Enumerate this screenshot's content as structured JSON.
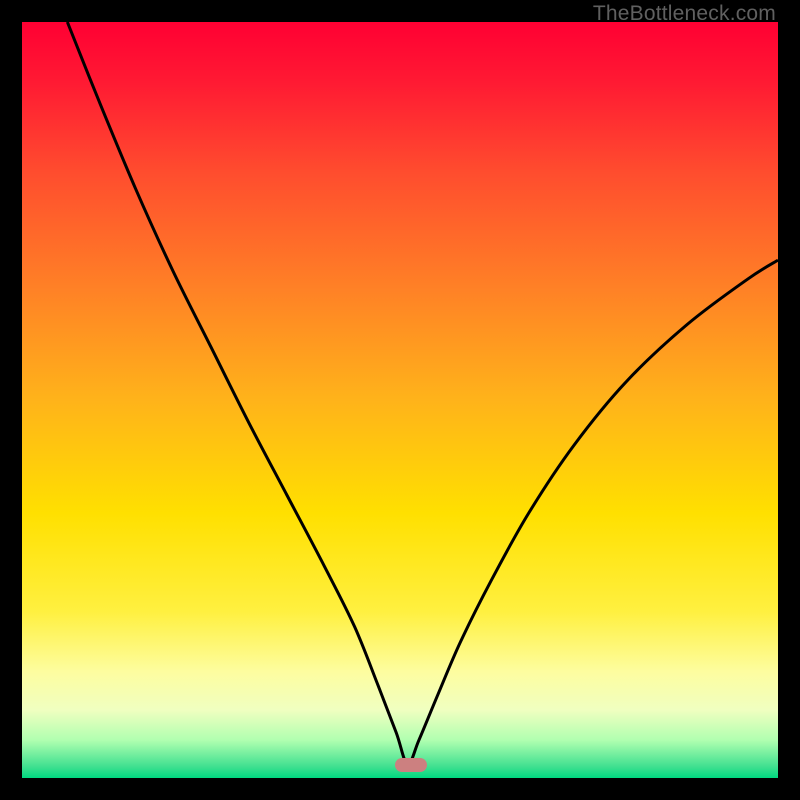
{
  "watermark_text": "TheBottleneck.com",
  "gradient_stops": [
    {
      "offset": 0.0,
      "color": "#ff0033"
    },
    {
      "offset": 0.08,
      "color": "#ff1a33"
    },
    {
      "offset": 0.2,
      "color": "#ff4d2e"
    },
    {
      "offset": 0.35,
      "color": "#ff8026"
    },
    {
      "offset": 0.5,
      "color": "#ffb31a"
    },
    {
      "offset": 0.65,
      "color": "#ffe000"
    },
    {
      "offset": 0.78,
      "color": "#fff040"
    },
    {
      "offset": 0.86,
      "color": "#fdfda0"
    },
    {
      "offset": 0.91,
      "color": "#f0ffc0"
    },
    {
      "offset": 0.95,
      "color": "#b0ffb0"
    },
    {
      "offset": 0.985,
      "color": "#40e090"
    },
    {
      "offset": 1.0,
      "color": "#00d880"
    }
  ],
  "marker": {
    "x_pct": 51.5,
    "y_pct": 98.3,
    "color": "#cc8080"
  },
  "curve_stroke": "#000000",
  "curve_stroke_width": 3,
  "chart_data": {
    "type": "line",
    "title": "",
    "xlabel": "",
    "ylabel": "",
    "xlim": [
      0,
      100
    ],
    "ylim": [
      0,
      100
    ],
    "note": "x and y are percentages of the plot area; y=0 is green (good), y=100 is red (bad). V-shaped bottleneck curve with minimum near x≈51.",
    "series": [
      {
        "name": "bottleneck-curve",
        "x": [
          6,
          10,
          15,
          20,
          25,
          30,
          35,
          40,
          44,
          47,
          49.5,
          51,
          52.5,
          55,
          58,
          62,
          67,
          73,
          80,
          88,
          96,
          100
        ],
        "y": [
          100,
          90,
          78,
          67,
          57,
          47,
          37.5,
          28,
          20,
          12.5,
          6,
          1.8,
          5,
          11,
          18,
          26,
          35,
          44,
          52.5,
          60,
          66,
          68.5
        ]
      }
    ],
    "marker_point": {
      "x": 51.5,
      "y": 1.7
    }
  }
}
